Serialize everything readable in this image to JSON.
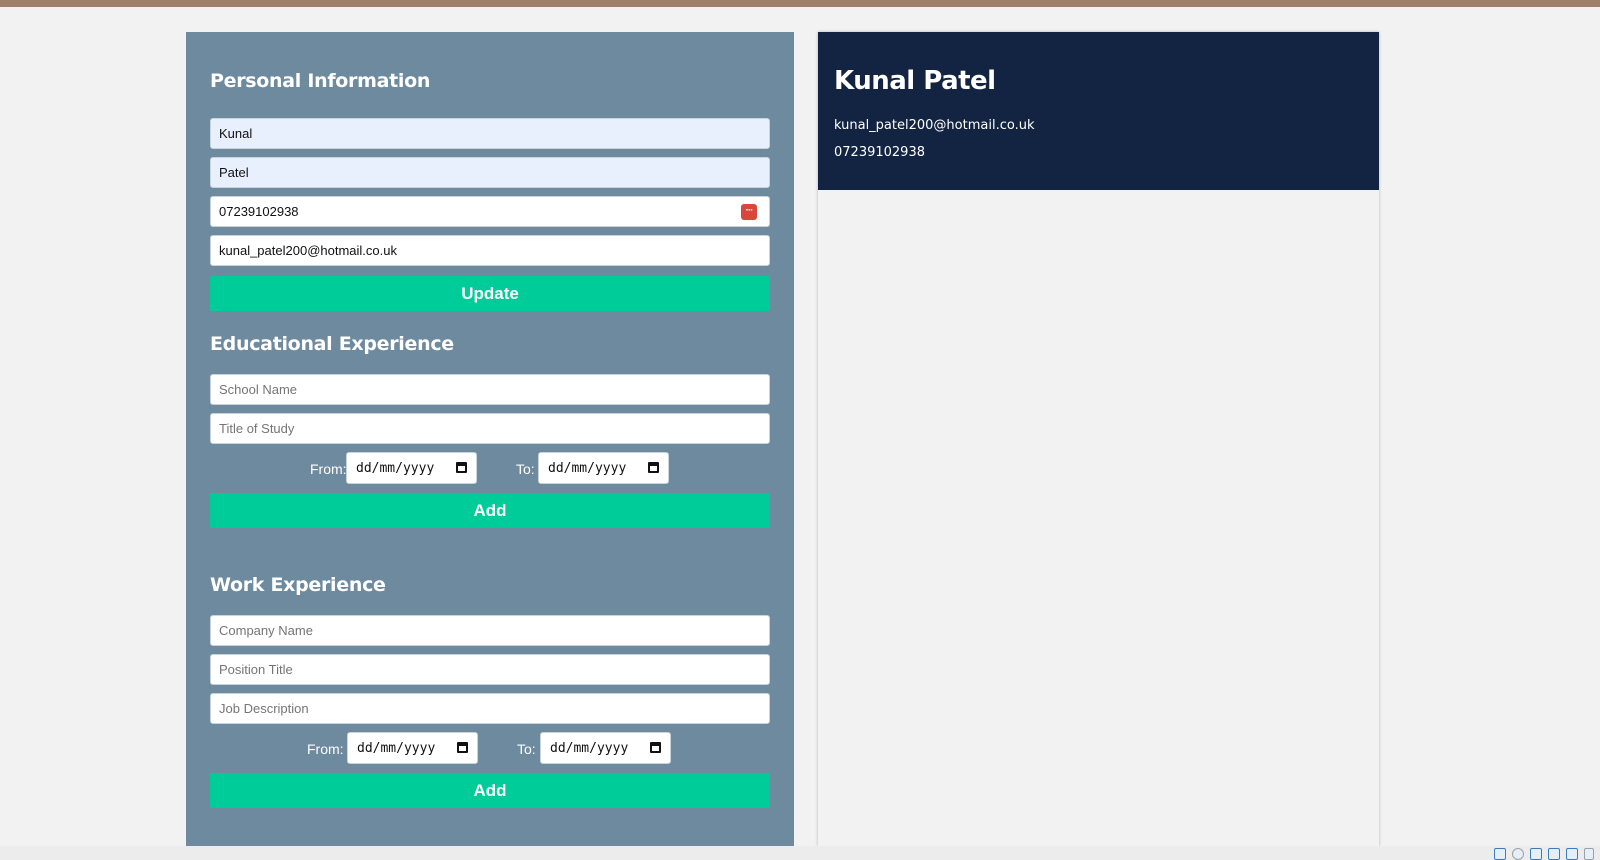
{
  "personal": {
    "heading": "Personal Information",
    "first_name": "Kunal",
    "last_name": "Patel",
    "phone": "07239102938",
    "email": "kunal_patel200@hotmail.co.uk",
    "update_label": "Update"
  },
  "education": {
    "heading": "Educational Experience",
    "school_placeholder": "School Name",
    "study_placeholder": "Title of Study",
    "from_label": "From:",
    "to_label": "To:",
    "date_placeholder": "dd/mm/yyyy",
    "add_label": "Add"
  },
  "work": {
    "heading": "Work Experience",
    "company_placeholder": "Company Name",
    "position_placeholder": "Position Title",
    "description_placeholder": "Job Description",
    "from_label": "From:",
    "to_label": "To:",
    "date_placeholder": "dd/mm/yyyy",
    "add_label": "Add"
  },
  "preview": {
    "name": "Kunal Patel",
    "email": "kunal_patel200@hotmail.co.uk",
    "phone": "07239102938"
  },
  "icons": {
    "autofill": "autofill-key-icon",
    "date_picker": "calendar-icon"
  },
  "colors": {
    "form_panel": "#6e8a9e",
    "button": "#00cc9a",
    "preview_header": "#132443",
    "top_bar": "#a1806b",
    "autofilled_field": "#e8f0fe"
  }
}
